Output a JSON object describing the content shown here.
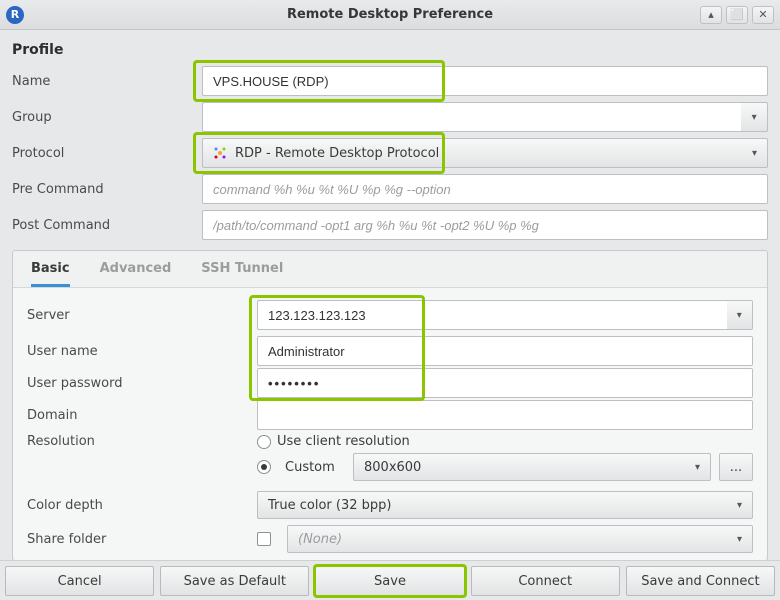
{
  "titlebar": {
    "title": "Remote Desktop Preference"
  },
  "profile": {
    "section_label": "Profile",
    "name_label": "Name",
    "name_value": "VPS.HOUSE (RDP)",
    "group_label": "Group",
    "group_value": "",
    "protocol_label": "Protocol",
    "protocol_value": "RDP - Remote Desktop Protocol",
    "precmd_label": "Pre Command",
    "precmd_placeholder": "command %h %u %t %U %p %g --option",
    "postcmd_label": "Post Command",
    "postcmd_placeholder": "/path/to/command -opt1 arg %h %u %t -opt2 %U %p %g"
  },
  "tabs": {
    "basic": "Basic",
    "advanced": "Advanced",
    "ssh": "SSH Tunnel"
  },
  "basic": {
    "server_label": "Server",
    "server_value": "123.123.123.123",
    "user_label": "User name",
    "user_value": "Administrator",
    "password_label": "User password",
    "password_value": "••••••••",
    "domain_label": "Domain",
    "domain_value": "",
    "resolution_label": "Resolution",
    "res_client_label": "Use client resolution",
    "res_custom_label": "Custom",
    "res_custom_value": "800x600",
    "res_more": "...",
    "colordepth_label": "Color depth",
    "colordepth_value": "True color (32 bpp)",
    "sharefolder_label": "Share folder",
    "sharefolder_value": "(None)"
  },
  "buttons": {
    "cancel": "Cancel",
    "save_default": "Save as Default",
    "save": "Save",
    "connect": "Connect",
    "save_connect": "Save and Connect"
  }
}
